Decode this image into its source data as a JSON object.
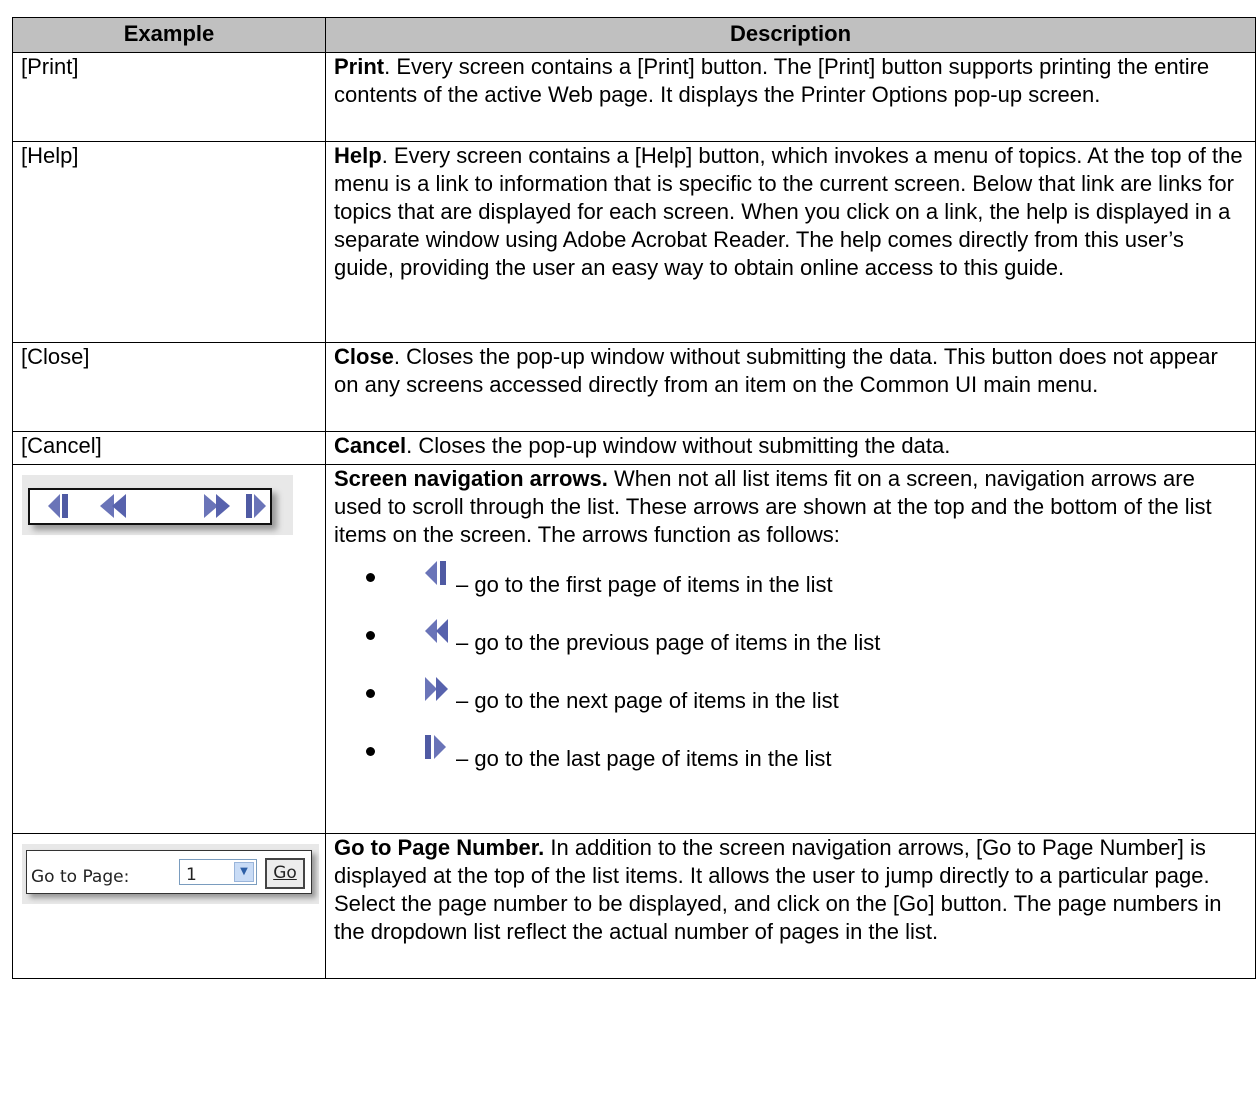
{
  "table": {
    "headers": [
      "Example",
      "Description"
    ],
    "rows": [
      {
        "example": "[Print]",
        "title": "Print",
        "text": ". Every screen contains a [Print] button. The [Print] button supports printing the entire contents of the active Web page. It displays the Printer Options pop-up screen."
      },
      {
        "example": "[Help]",
        "title": "Help",
        "text": ". Every screen contains a [Help] button, which invokes a menu of topics. At the top of the menu is a link to information that is specific to the current screen. Below that link are links for topics that are displayed for each screen. When you click on a link, the help is displayed in a separate window using Adobe Acrobat Reader. The help comes directly from this user’s guide, providing the user an easy way to obtain online access to this guide."
      },
      {
        "example": "[Close]",
        "title": "Close",
        "text": ". Closes the pop-up window without submitting the data. This button does not appear on any screens accessed directly from an item on the Common UI main menu."
      },
      {
        "example": "[Cancel]",
        "title": "Cancel",
        "text": ". Closes the pop-up window without submitting the data."
      },
      {
        "title": "Screen navigation arrows.",
        "text": " When not all list items fit on a screen, navigation arrows are used to scroll through the list. These arrows are shown at the top and the bottom of the list items on the screen. The arrows function as follows:",
        "bullets": [
          {
            "icon": "first-page-icon",
            "text": "– go to the first page of items in the list"
          },
          {
            "icon": "previous-page-icon",
            "text": "– go to the previous page of items in the list"
          },
          {
            "icon": "next-page-icon",
            "text": "– go to the next page of items in the list"
          },
          {
            "icon": "last-page-icon",
            "text": "– go to the last page of items in the list"
          }
        ]
      },
      {
        "title": "Go to Page Number.",
        "text": " In addition to the screen navigation arrows, [Go to Page Number] is displayed at the top of the list items. It allows the user to jump directly to a particular page. Select the page number to be displayed, and click on the [Go] button. The page numbers in the dropdown list reflect the actual number of pages in the list.",
        "widget": {
          "label": "Go to Page:",
          "selected": "1",
          "button": "Go"
        }
      }
    ]
  },
  "colors": {
    "header_bg": "#c0c0c0",
    "arrow_blue": "#6a74b8",
    "dropdown_blue": "#c9dcf6"
  }
}
